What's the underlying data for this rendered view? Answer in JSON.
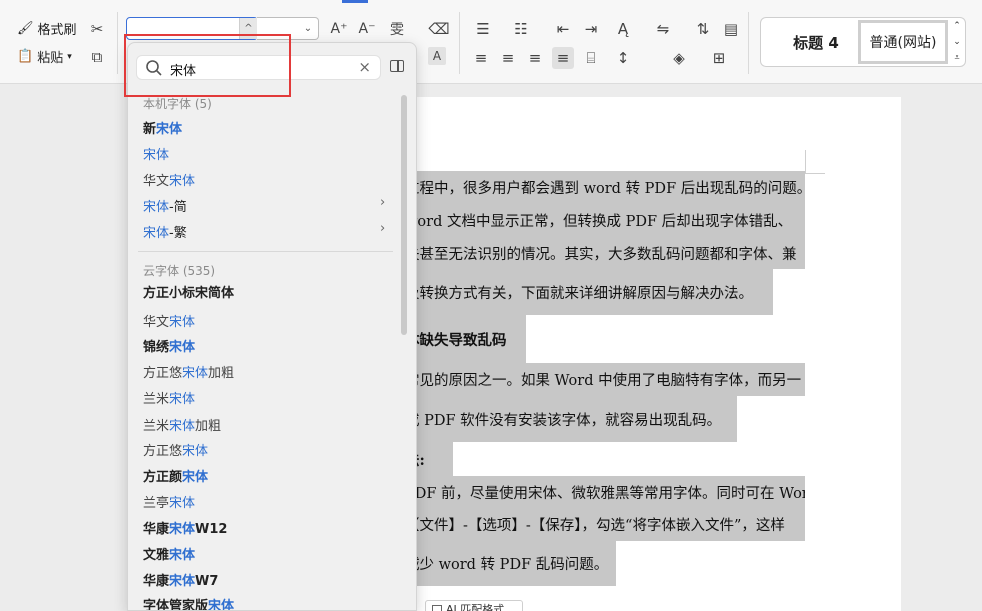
{
  "ribbon": {
    "format_painter": "格式刷",
    "paste": "粘贴",
    "style_heading4": "标题 4",
    "style_normal": "普通(网站)"
  },
  "font_panel": {
    "search_value": "宋体",
    "groups": [
      {
        "title": "本机字体 (5)",
        "items": [
          {
            "pre": "新",
            "hit": "宋体",
            "post": ""
          },
          {
            "pre": "",
            "hit": "宋体",
            "post": ""
          },
          {
            "pre": "华文",
            "hit": "宋体",
            "post": ""
          },
          {
            "pre": "",
            "hit": "宋体",
            "post": "-简"
          },
          {
            "pre": "",
            "hit": "宋体",
            "post": "-繁"
          }
        ]
      },
      {
        "title": "云字体 (535)",
        "items": [
          {
            "text": "方正小标宋简体"
          },
          {
            "pre": "华文",
            "hit": "宋体",
            "post": ""
          },
          {
            "pre": "锦绣",
            "hit": "宋体",
            "post": ""
          },
          {
            "pre": "方正悠",
            "hit": "宋体",
            "post": "加粗"
          },
          {
            "pre": "兰米",
            "hit": "宋体",
            "post": ""
          },
          {
            "pre": "兰米",
            "hit": "宋体",
            "post": "加粗"
          },
          {
            "pre": "方正悠",
            "hit": "宋体",
            "post": ""
          },
          {
            "pre": "方正颜",
            "hit": "宋体",
            "post": ""
          },
          {
            "pre": "兰亭",
            "hit": "宋体",
            "post": ""
          },
          {
            "pre": "华康",
            "hit": "宋体",
            "post": "W12"
          },
          {
            "pre": "文雅",
            "hit": "宋体",
            "post": ""
          },
          {
            "pre": "华康",
            "hit": "宋体",
            "post": "W7"
          },
          {
            "pre": "字体管家版",
            "hit": "宋体",
            "post": ""
          }
        ]
      }
    ]
  },
  "document": {
    "p1_l1": "过程中，很多用户都会遇到 word 转 PDF 后出现乱码的问题。",
    "p1_l2": " word 文档中显示正常，但转换成 PDF 后却出现字体错乱、",
    "p1_l3": "失甚至无法识别的情况。其实，大多数乱码问题都和字体、兼",
    "p1_l4": "及转换方式有关，下面就来详细讲解原因与解决办法。",
    "heading1": "体缺失导致乱码",
    "p2_l1": "常见的原因之一。如果 Word 中使用了电脑特有字体，而另一",
    "p2_l2": "或 PDF 软件没有安装该字体，就容易出现乱码。",
    "heading2": "法:",
    "p3_l1": " PDF 前，尽量使用宋体、微软雅黑等常用字体。同时可在 Word",
    "p3_l2": "【文件】-【选项】-【保存】，勾选“将字体嵌入文件”，这样",
    "p3_l3": "减少 word 转 PDF 乱码问题。",
    "paste_hint": "AI 匹配格式"
  },
  "colors": {
    "accent": "#3a6fd8",
    "match_highlight": "#2f6fd0",
    "callout_red": "#e23a3a",
    "text_selection": "#c7c7c7"
  }
}
